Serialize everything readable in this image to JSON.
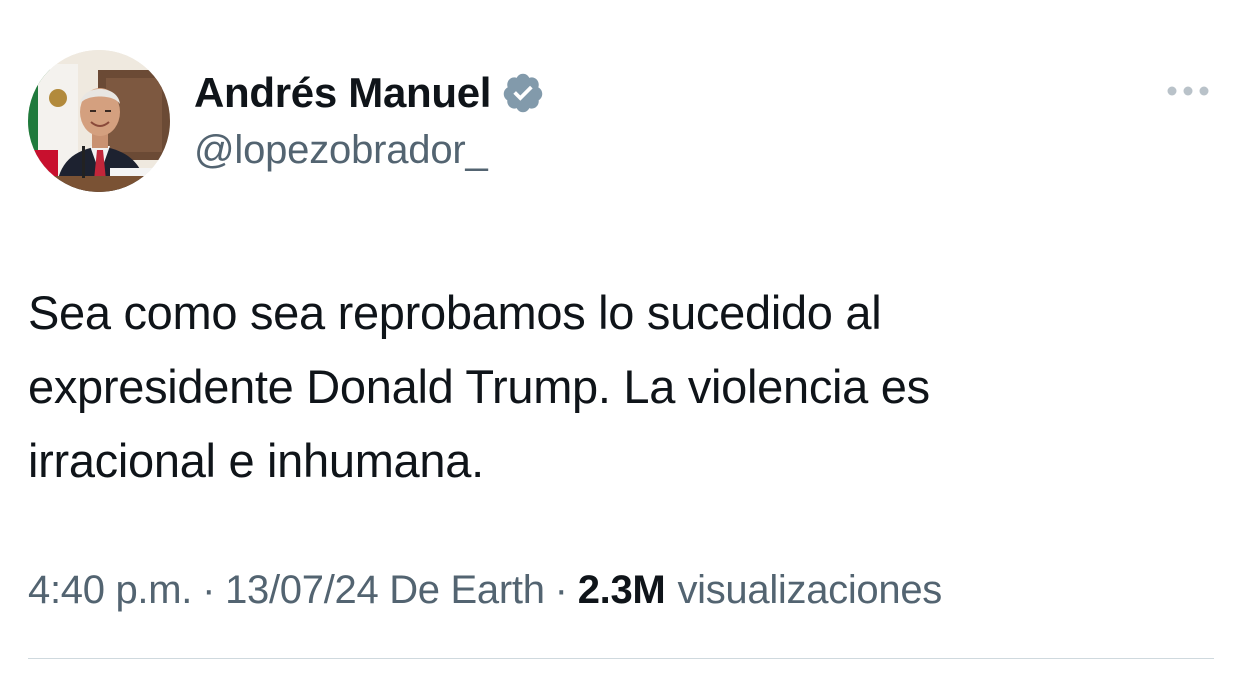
{
  "author": {
    "display_name": "Andrés Manuel",
    "handle": "@lopezobrador_",
    "verified": true,
    "verified_color": "#829aab"
  },
  "tweet": {
    "text": "Sea como sea reprobamos lo sucedido al\nexpresidente Donald Trump. La violencia es\nirracional e inhumana."
  },
  "meta": {
    "time": "4:40 p.m.",
    "separator": "·",
    "date_source": "13/07/24 De Earth",
    "views_count": "2.3M",
    "views_label": "visualizaciones"
  },
  "icons": {
    "more": "more-horizontal-icon",
    "verified": "verified-badge-icon"
  },
  "colors": {
    "text_primary": "#0f1419",
    "text_secondary": "#536471",
    "divider": "#cfd9de"
  }
}
